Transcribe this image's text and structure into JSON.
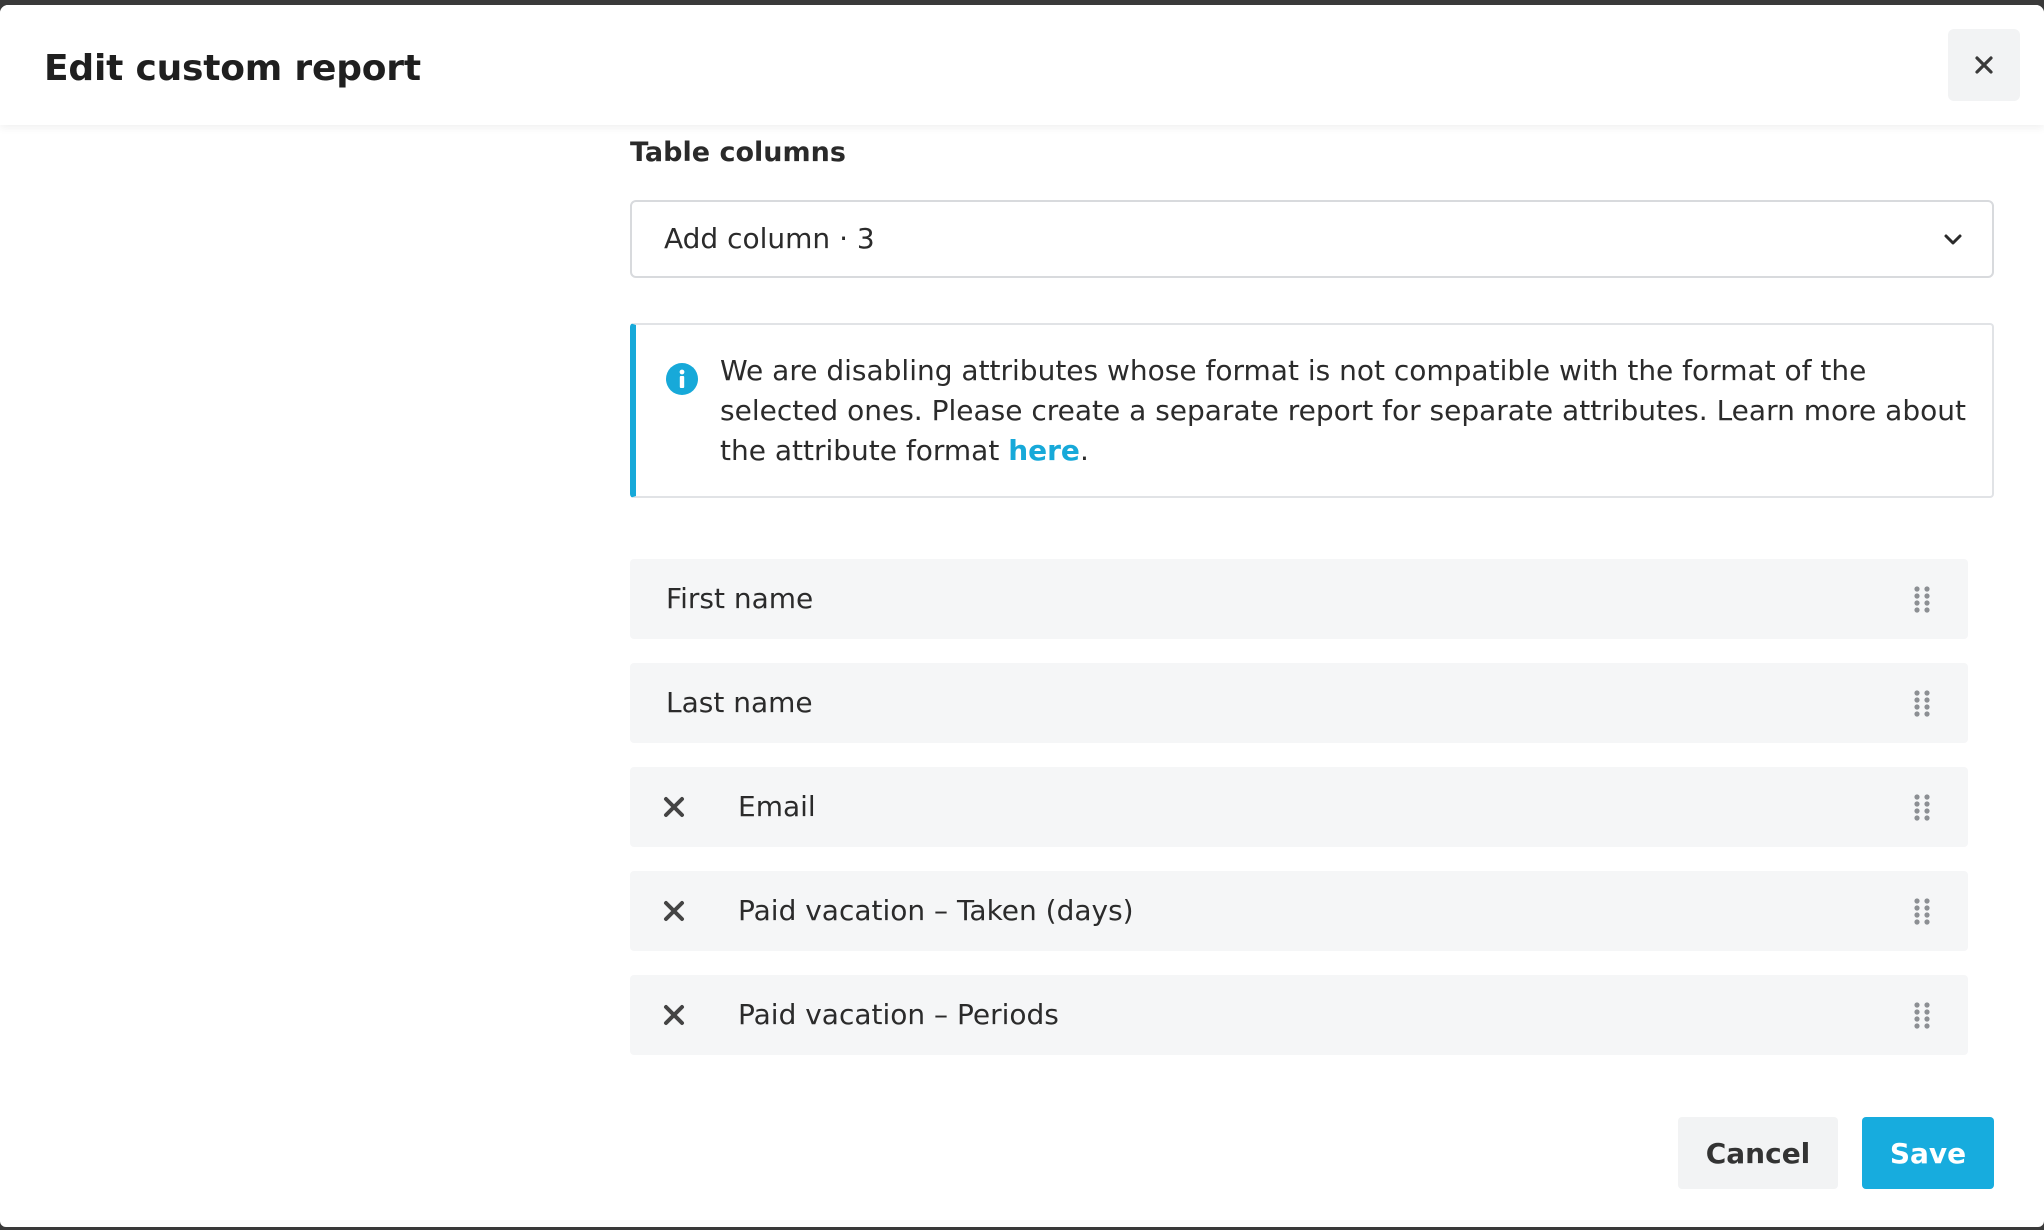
{
  "dialog": {
    "title": "Edit custom report",
    "close_icon": "close-icon"
  },
  "columns_section": {
    "label": "Table columns",
    "select": {
      "value": "Add column · 3",
      "icon": "chevron-down-icon"
    }
  },
  "info": {
    "icon": "info-icon",
    "accent_color": "#17a9d9",
    "text_before_link": "We are disabling attributes whose format is not compatible with the format of the selected ones. Please create a separate report for separate attributes. Learn more about the attribute format ",
    "link_text": "here",
    "text_after_link": "."
  },
  "columns": [
    {
      "label": "First name",
      "removable": false,
      "drag_icon": "drag-handle-icon"
    },
    {
      "label": "Last name",
      "removable": false,
      "drag_icon": "drag-handle-icon"
    },
    {
      "label": "Email",
      "removable": true,
      "remove_icon": "close-icon",
      "drag_icon": "drag-handle-icon"
    },
    {
      "label": "Paid vacation – Taken (days)",
      "removable": true,
      "remove_icon": "close-icon",
      "drag_icon": "drag-handle-icon"
    },
    {
      "label": "Paid vacation – Periods",
      "removable": true,
      "remove_icon": "close-icon",
      "drag_icon": "drag-handle-icon"
    }
  ],
  "footer": {
    "cancel_label": "Cancel",
    "save_label": "Save",
    "save_color": "#17acde"
  }
}
